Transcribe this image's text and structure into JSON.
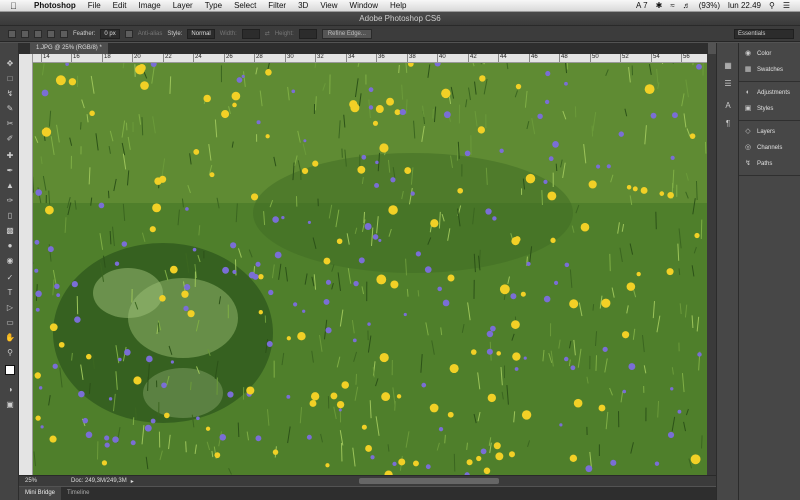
{
  "menubar": {
    "app_name": "Photoshop",
    "items": [
      "File",
      "Edit",
      "Image",
      "Layer",
      "Type",
      "Select",
      "Filter",
      "3D",
      "View",
      "Window",
      "Help"
    ],
    "status": {
      "adobe": "A 7",
      "battery": "(93%)",
      "clock": "lun 22.49"
    }
  },
  "window": {
    "title": "Adobe Photoshop CS6"
  },
  "options_bar": {
    "feather_label": "Feather:",
    "feather_value": "0 px",
    "antialias_label": "Anti-alias",
    "style_label": "Style:",
    "style_value": "Normal",
    "width_label": "Width:",
    "height_label": "Height:",
    "refine_edge_label": "Refine Edge...",
    "workspace_value": "Essentials"
  },
  "document_tab": {
    "label": "1.JPG @ 25% (RGB/8) *"
  },
  "ruler": {
    "ticks": [
      "14",
      "16",
      "18",
      "20",
      "22",
      "24",
      "26",
      "28",
      "30",
      "32",
      "34",
      "36",
      "38",
      "40",
      "42",
      "44",
      "46",
      "48",
      "50",
      "52",
      "54",
      "56"
    ]
  },
  "status_bar": {
    "zoom": "25%",
    "doc_info": "Doc: 249,3M/249,3M"
  },
  "bottom_tabs": {
    "mini_bridge": "Mini Bridge",
    "timeline": "Timeline"
  },
  "panels": {
    "group1": [
      "Color",
      "Swatches"
    ],
    "group2": [
      "Adjustments",
      "Styles"
    ],
    "group3": [
      "Layers",
      "Channels",
      "Paths"
    ]
  },
  "colors": {
    "menubar": "#e6e6e6",
    "chrome": "#535353",
    "grass": "#4a7a28",
    "dandelion": "#f2d026",
    "violet": "#7a6ed6"
  }
}
